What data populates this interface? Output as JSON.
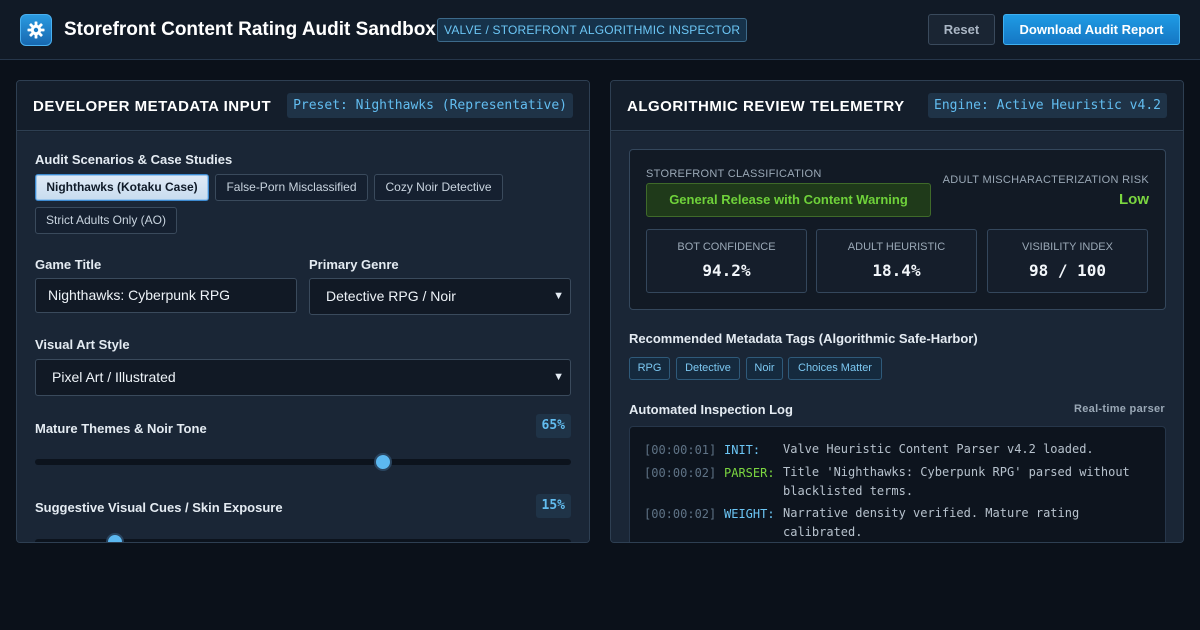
{
  "header": {
    "title": "Storefront Content Rating Audit Sandbox",
    "badge": "VALVE / STOREFRONT ALGORITHMIC INSPECTOR",
    "reset_label": "Reset",
    "download_label": "Download Audit Report",
    "logo_icon": "gear-icon"
  },
  "left_panel": {
    "title": "DEVELOPER METADATA INPUT",
    "preset": "Preset: Nighthawks (Representative)",
    "scenarios_label": "Audit Scenarios & Case Studies",
    "scenarios": [
      {
        "label": "Nighthawks (Kotaku Case)",
        "active": true
      },
      {
        "label": "False-Porn Misclassified",
        "active": false
      },
      {
        "label": "Cozy Noir Detective",
        "active": false
      },
      {
        "label": "Strict Adults Only (AO)",
        "active": false
      }
    ],
    "game_title_label": "Game Title",
    "game_title_value": "Nighthawks: Cyberpunk RPG",
    "genre_label": "Primary Genre",
    "genre_value": "Detective RPG / Noir",
    "art_style_label": "Visual Art Style",
    "art_style_value": "Pixel Art / Illustrated",
    "sliders": [
      {
        "label": "Mature Themes & Noir Tone",
        "display": "65%",
        "value": 0.65
      },
      {
        "label": "Suggestive Visual Cues / Skin Exposure",
        "display": "15%",
        "value": 0.15
      }
    ]
  },
  "right_panel": {
    "title": "ALGORITHMIC REVIEW TELEMETRY",
    "engine": "Engine: Active Heuristic v4.2",
    "classification_label": "STOREFRONT CLASSIFICATION",
    "classification_value": "General Release with Content Warning",
    "risk_label": "ADULT MISCHARACTERIZATION RISK",
    "risk_value": "Low",
    "metrics": [
      {
        "label": "BOT CONFIDENCE",
        "value": "94.2%"
      },
      {
        "label": "ADULT HEURISTIC",
        "value": "18.4%"
      },
      {
        "label": "VISIBILITY INDEX",
        "value": "98 / 100"
      }
    ],
    "tags_label": "Recommended Metadata Tags (Algorithmic Safe-Harbor)",
    "tags": [
      "RPG",
      "Detective",
      "Noir",
      "Choices Matter"
    ],
    "log_label": "Automated Inspection Log",
    "log_hint": "Real-time parser",
    "log": [
      {
        "time": "[00:00:01]",
        "key": "INIT:",
        "msg": "Valve Heuristic Content Parser v4.2 loaded."
      },
      {
        "time": "[00:00:02]",
        "key": "PARSER:",
        "msg": "Title 'Nighthawks: Cyberpunk RPG' parsed without blacklisted terms."
      },
      {
        "time": "[00:00:02]",
        "key": "WEIGHT:",
        "msg": "Narrative density verified. Mature rating calibrated."
      }
    ]
  },
  "colors": {
    "accent": "#1f9be4",
    "success": "#6fd23a",
    "log_init": "#6cc6f5",
    "log_parser": "#7bd640",
    "log_weight": "#6cc6f5"
  }
}
